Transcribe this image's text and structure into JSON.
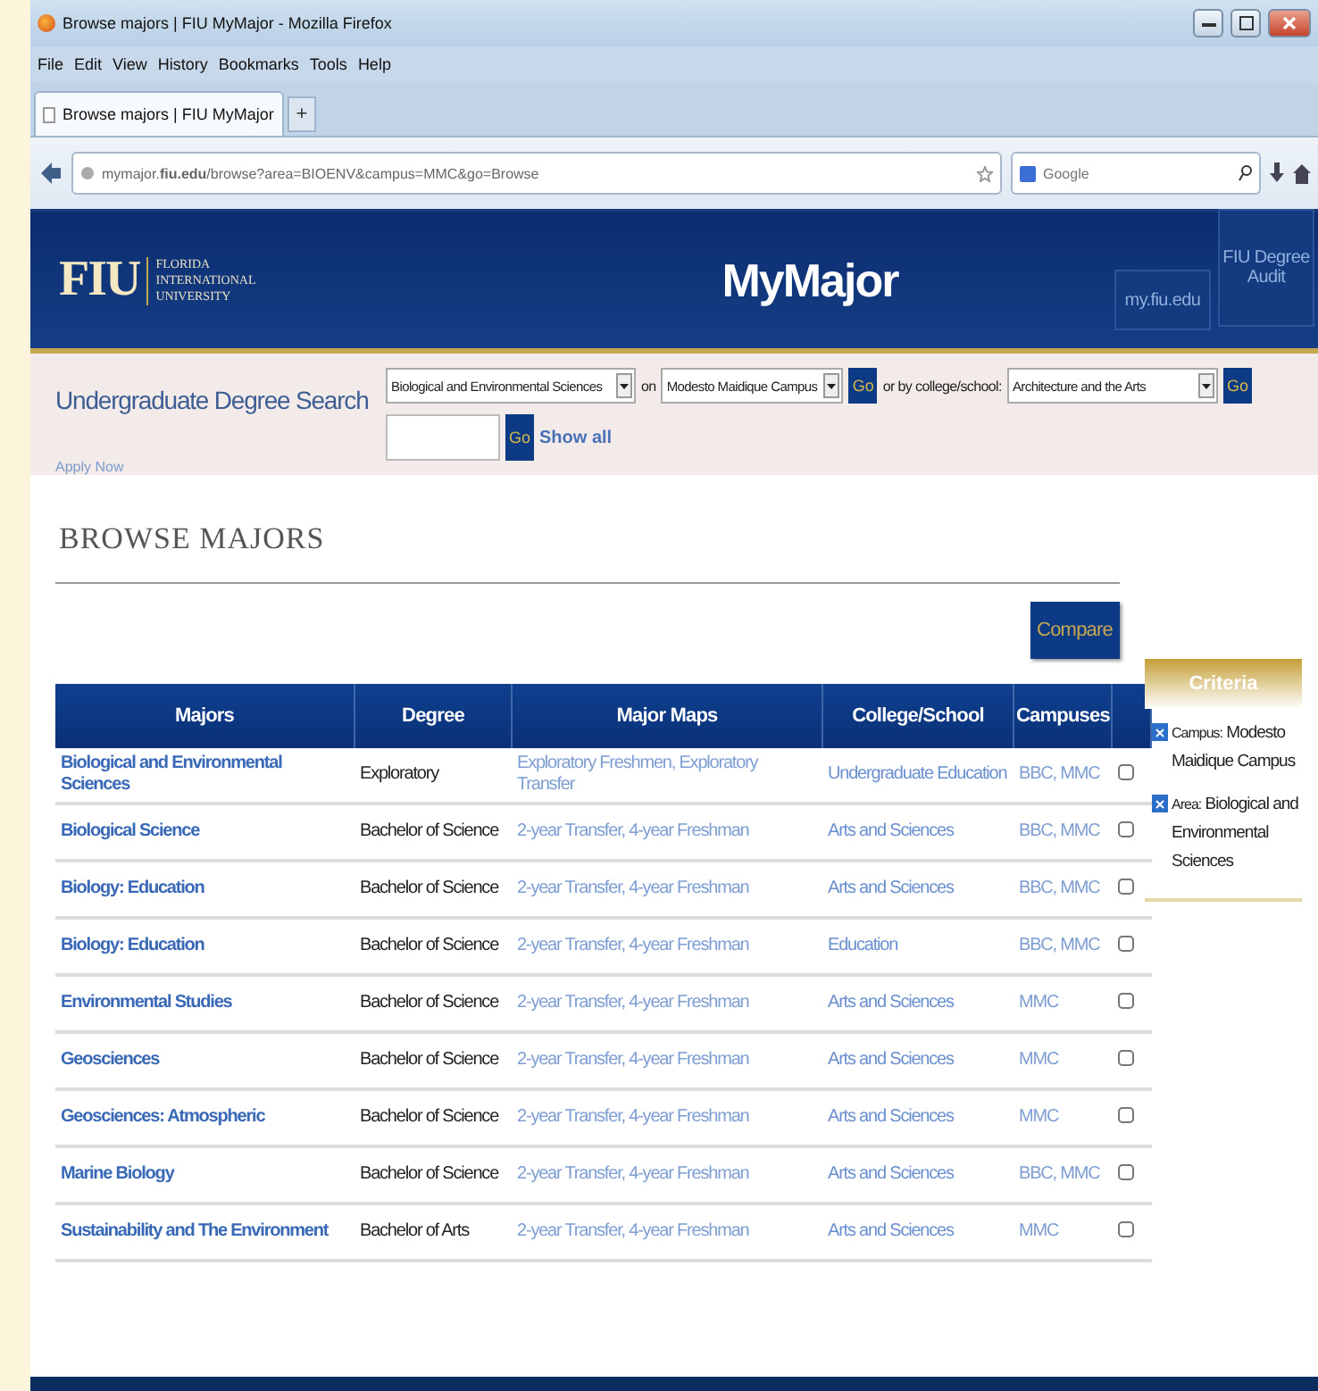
{
  "window": {
    "title": "Browse majors | FIU MyMajor - Mozilla Firefox"
  },
  "menu": [
    "File",
    "Edit",
    "View",
    "History",
    "Bookmarks",
    "Tools",
    "Help"
  ],
  "tabs": [
    {
      "label": "Browse majors | FIU MyMajor",
      "selected": true
    }
  ],
  "new_tab": "+",
  "address": "mymajor.**fiu.edu**/browse?area=BIOENV&campus=MMC&go=Browse",
  "browser_search": {
    "placeholder": "Google"
  },
  "header": {
    "logo_mark": "FIU",
    "logo_text": [
      "FLORIDA",
      "INTERNATIONAL",
      "UNIVERSITY"
    ],
    "title": "MyMajor",
    "links": [
      "my.fiu.edu",
      "FIU Degree Audit"
    ]
  },
  "search": {
    "title": "Undergraduate Degree Search",
    "apply": "Apply Now",
    "area": "Biological and Environmental Sciences",
    "on": "on",
    "campus": "Modesto Maidique Campus",
    "go": "Go",
    "or_label": "or by college/school:",
    "college": "Architecture and the Arts",
    "go2": "Go",
    "go3": "Go",
    "show_all": "Show all"
  },
  "heading": "BROWSE MAJORS",
  "compare": "Compare",
  "table": {
    "columns": [
      "Majors",
      "Degree",
      "Major Maps",
      "College/School",
      "Campuses"
    ],
    "rows": [
      {
        "major": "Biological and Environmental Sciences",
        "degree": "Exploratory",
        "maps": "Exploratory Freshmen, Exploratory Transfer",
        "college": "Undergraduate Education",
        "campuses": "BBC, MMC",
        "checked": false
      },
      {
        "major": "Biological Science",
        "degree": "Bachelor of Science",
        "maps": "2-year Transfer, 4-year Freshman",
        "college": "Arts and Sciences",
        "campuses": "BBC, MMC",
        "checked": false
      },
      {
        "major": "Biology: Education",
        "degree": "Bachelor of Science",
        "maps": "2-year Transfer, 4-year Freshman",
        "college": "Arts and Sciences",
        "campuses": "BBC, MMC",
        "checked": false
      },
      {
        "major": "Biology: Education",
        "degree": "Bachelor of Science",
        "maps": "2-year Transfer, 4-year Freshman",
        "college": "Education",
        "campuses": "BBC, MMC",
        "checked": false
      },
      {
        "major": "Environmental Studies",
        "degree": "Bachelor of Science",
        "maps": "2-year Transfer, 4-year Freshman",
        "college": "Arts and Sciences",
        "campuses": "MMC",
        "checked": false
      },
      {
        "major": "Geosciences",
        "degree": "Bachelor of Science",
        "maps": "2-year Transfer, 4-year Freshman",
        "college": "Arts and Sciences",
        "campuses": "MMC",
        "checked": false
      },
      {
        "major": "Geosciences: Atmospheric",
        "degree": "Bachelor of Science",
        "maps": "2-year Transfer, 4-year Freshman",
        "college": "Arts and Sciences",
        "campuses": "MMC",
        "checked": false
      },
      {
        "major": "Marine Biology",
        "degree": "Bachelor of Science",
        "maps": "2-year Transfer, 4-year Freshman",
        "college": "Arts and Sciences",
        "campuses": "BBC, MMC",
        "checked": false
      },
      {
        "major": "Sustainability and The Environment",
        "degree": "Bachelor of Arts",
        "maps": "2-year Transfer, 4-year Freshman",
        "college": "Arts and Sciences",
        "campuses": "MMC",
        "checked": false
      }
    ]
  },
  "criteria": {
    "title": "Criteria",
    "items": [
      {
        "label": "Campus:",
        "value": "Modesto Maidique Campus"
      },
      {
        "label": "Area:",
        "value": "Biological and Environmental Sciences"
      }
    ]
  }
}
